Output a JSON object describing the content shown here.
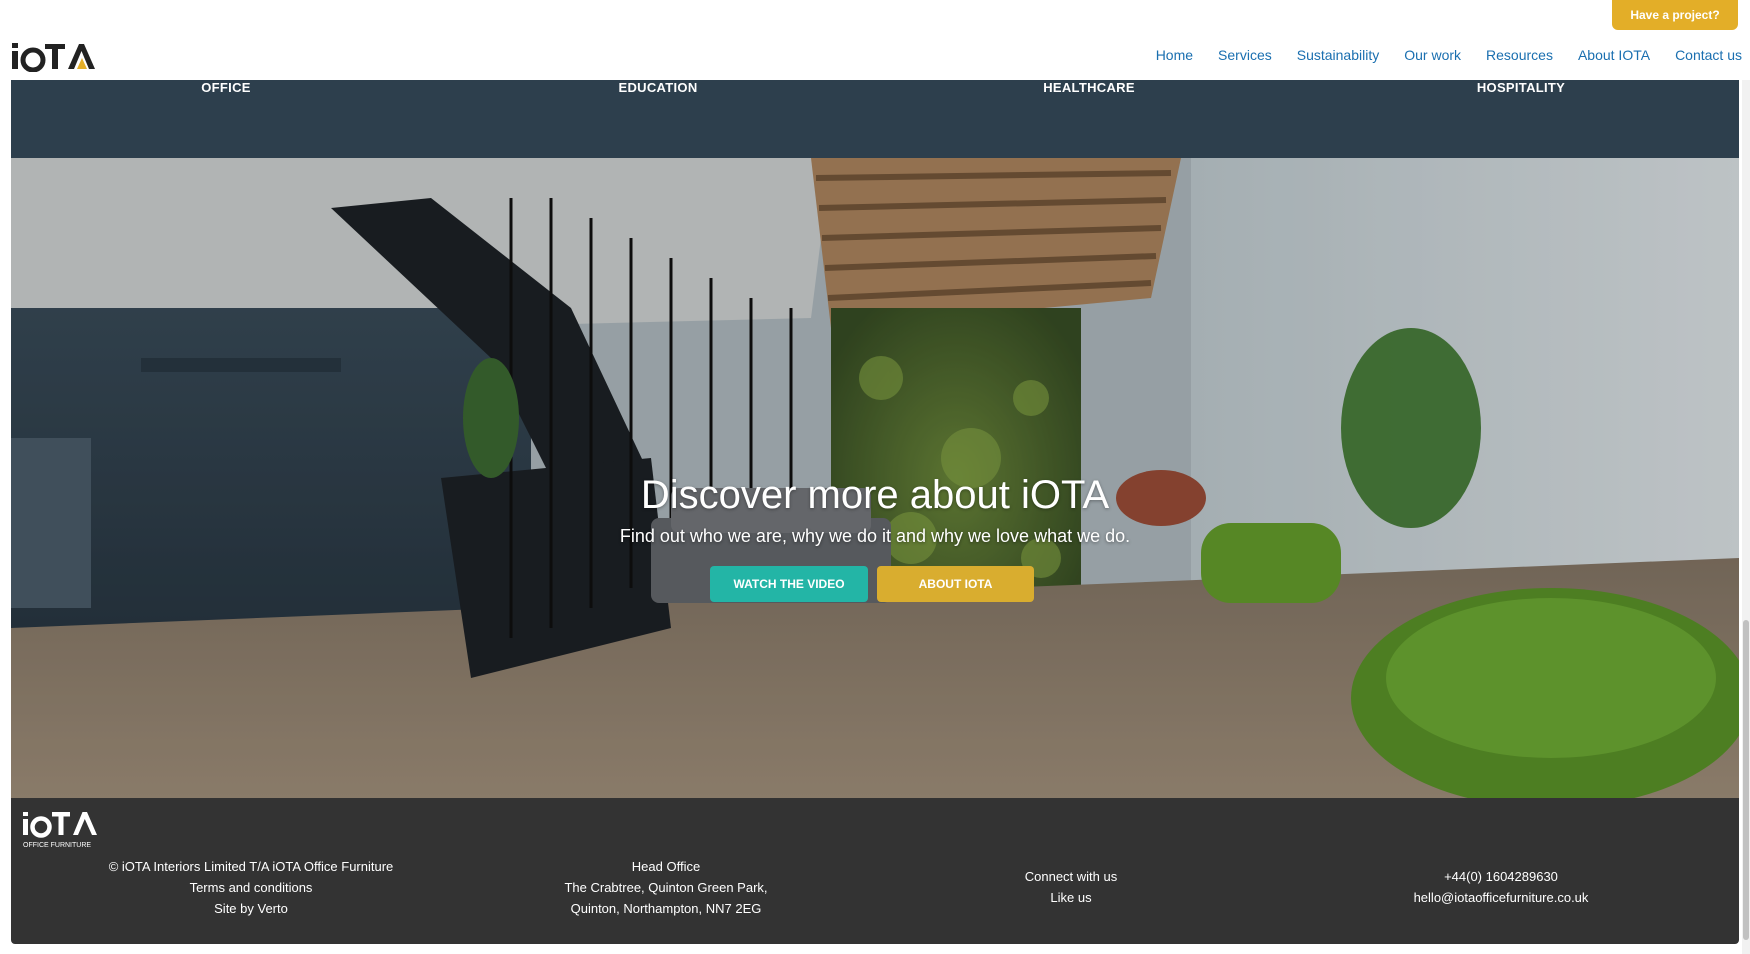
{
  "header": {
    "cta": "Have a project?",
    "nav": [
      "Home",
      "Services",
      "Sustainability",
      "Our work",
      "Resources",
      "About IOTA",
      "Contact us"
    ]
  },
  "sectors": [
    "OFFICE",
    "EDUCATION",
    "HEALTHCARE",
    "HOSPITALITY"
  ],
  "hero": {
    "title": "Discover more about iOTA",
    "subtitle": "Find out who we are, why we do it and why we love what we do.",
    "watch_label": "WATCH THE VIDEO",
    "about_label": "ABOUT iOTA"
  },
  "footer": {
    "logo_sub": "OFFICE FURNITURE",
    "copyright": "© iOTA Interiors Limited T/A iOTA Office Furniture",
    "terms": "Terms and conditions",
    "site_by": "Site by Verto",
    "head_office_label": "Head Office",
    "address_line1": "The Crabtree, Quinton Green Park,",
    "address_line2": "Quinton, Northampton, NN7 2EG",
    "connect": "Connect with us",
    "like": "Like us",
    "phone": "+44(0) 1604289630",
    "email": "hello@iotaofficefurniture.co.uk"
  },
  "colors": {
    "nav_link": "#1a6fb0",
    "cta_yellow": "#e3ae28",
    "teal": "#23b5a6",
    "gold": "#d9ad2f",
    "sector_strip": "#2d3f4d",
    "footer_bg": "#333333"
  }
}
